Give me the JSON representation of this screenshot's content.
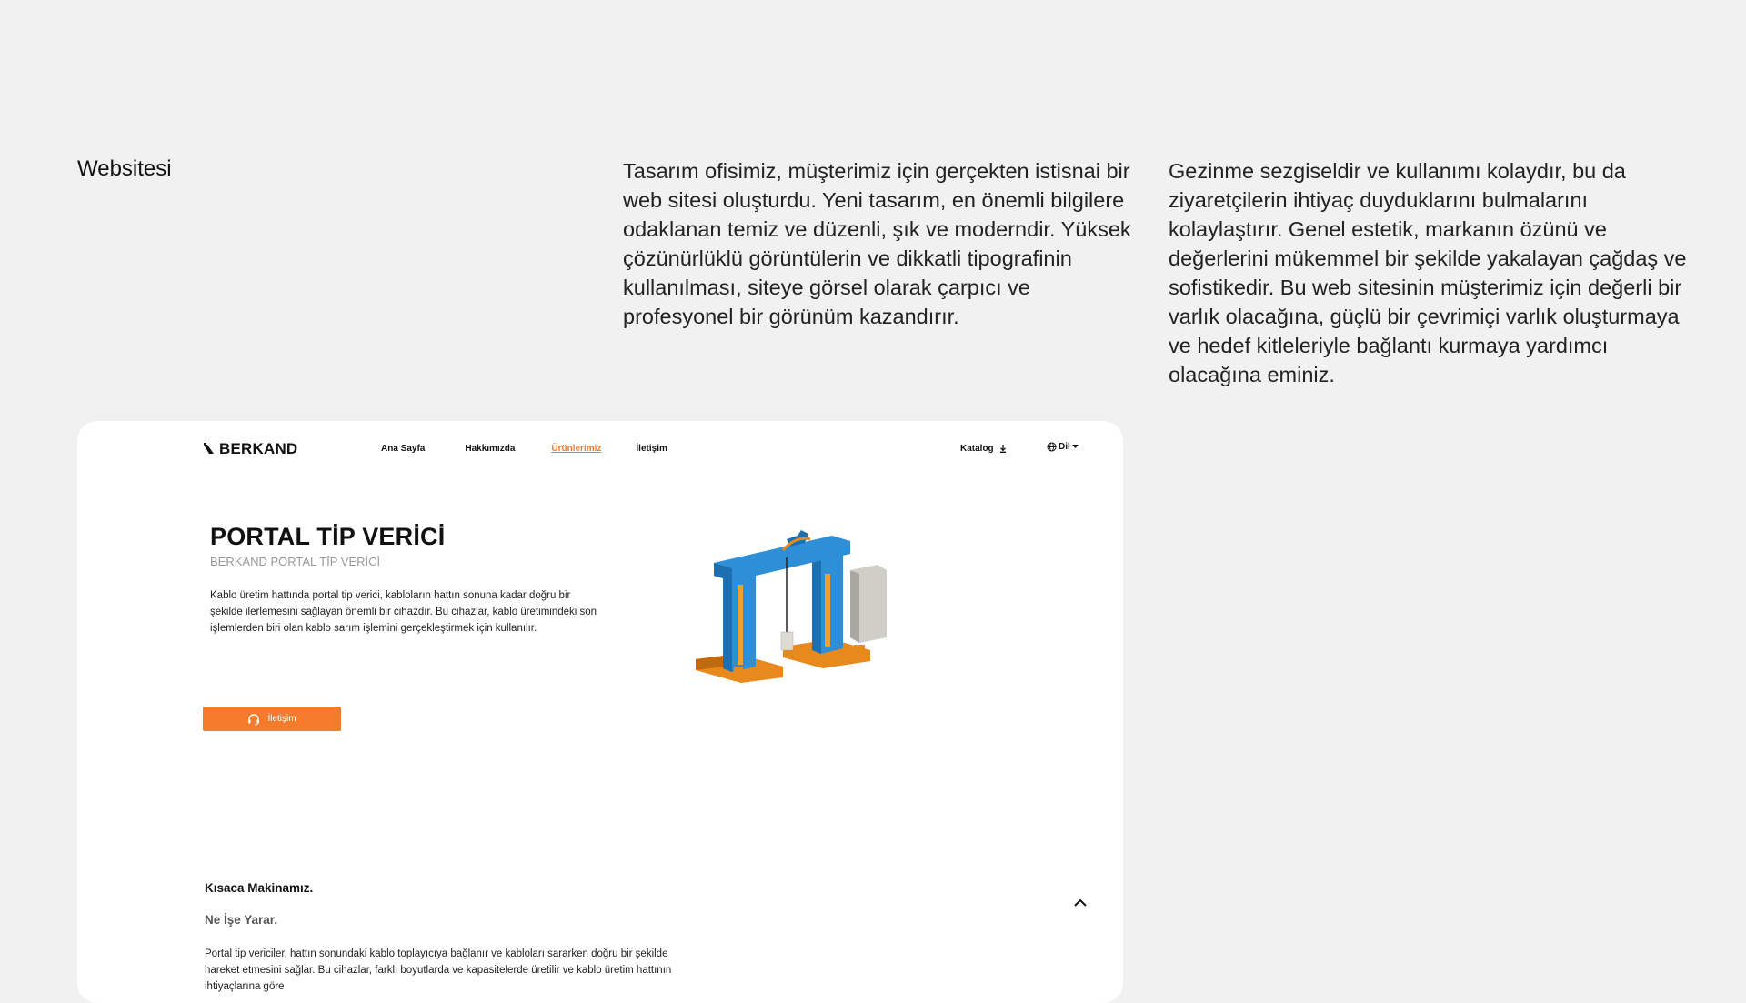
{
  "intro": {
    "title": "Websitesi",
    "paragraph_left": "Tasarım ofisimiz, müşterimiz için gerçekten istisnai bir web sitesi oluşturdu. Yeni tasarım, en önemli bilgilere odaklanan temiz ve düzenli, şık ve moderndir. Yüksek çözünürlüklü görüntülerin ve dikkatli tipografinin kullanılması, siteye görsel olarak çarpıcı ve profesyonel bir görünüm kazandırır.",
    "paragraph_right": "Gezinme sezgiseldir ve kullanımı kolaydır, bu da ziyaretçilerin ihtiyaç duyduklarını bulmalarını kolaylaştırır. Genel estetik, markanın özünü ve değerlerini mükemmel bir şekilde yakalayan çağdaş ve sofistikedir. Bu web sitesinin müşterimiz için değerli bir varlık olacağına, güçlü bir çevrimiçi varlık oluşturmaya ve hedef kitleleriyle bağlantı kurmaya yardımcı olacağına eminiz."
  },
  "site": {
    "logo": "BERKAND",
    "nav": [
      "Ana Sayfa",
      "Hakkımızda",
      "Ürünlerimiz",
      "İletişim"
    ],
    "active_nav": "Ürünlerimiz",
    "katalog": "Katalog",
    "lang": "Dil",
    "product": {
      "title": "PORTAL TİP VERİCİ",
      "subtitle": "BERKAND PORTAL TİP VERİCİ",
      "description": "Kablo üretim hattında portal tip verici, kabloların hattın sonuna kadar doğru bir şekilde ilerlemesini sağlayan önemli bir cihazdır. Bu cihazlar, kablo üretimindeki son işlemlerden biri olan kablo sarım işlemini gerçekleştirmek için kullanılır.",
      "cta": "İletişim"
    },
    "section": {
      "heading": "Kısaca Makinamız.",
      "subheading": "Ne İşe Yarar.",
      "body": "Portal tip vericiler, hattın sonundaki kablo toplayıcıya bağlanır ve kabloları sararken doğru bir şekilde hareket etmesini sağlar. Bu cihazlar, farklı boyutlarda ve kapasitelerde üretilir ve kablo üretim hattının ihtiyaçlarına göre"
    },
    "colors": {
      "accent": "#f47b2b",
      "machine_frame": "#2e8fd6",
      "machine_base": "#e8891e",
      "panel": "#cfcfc8"
    }
  }
}
